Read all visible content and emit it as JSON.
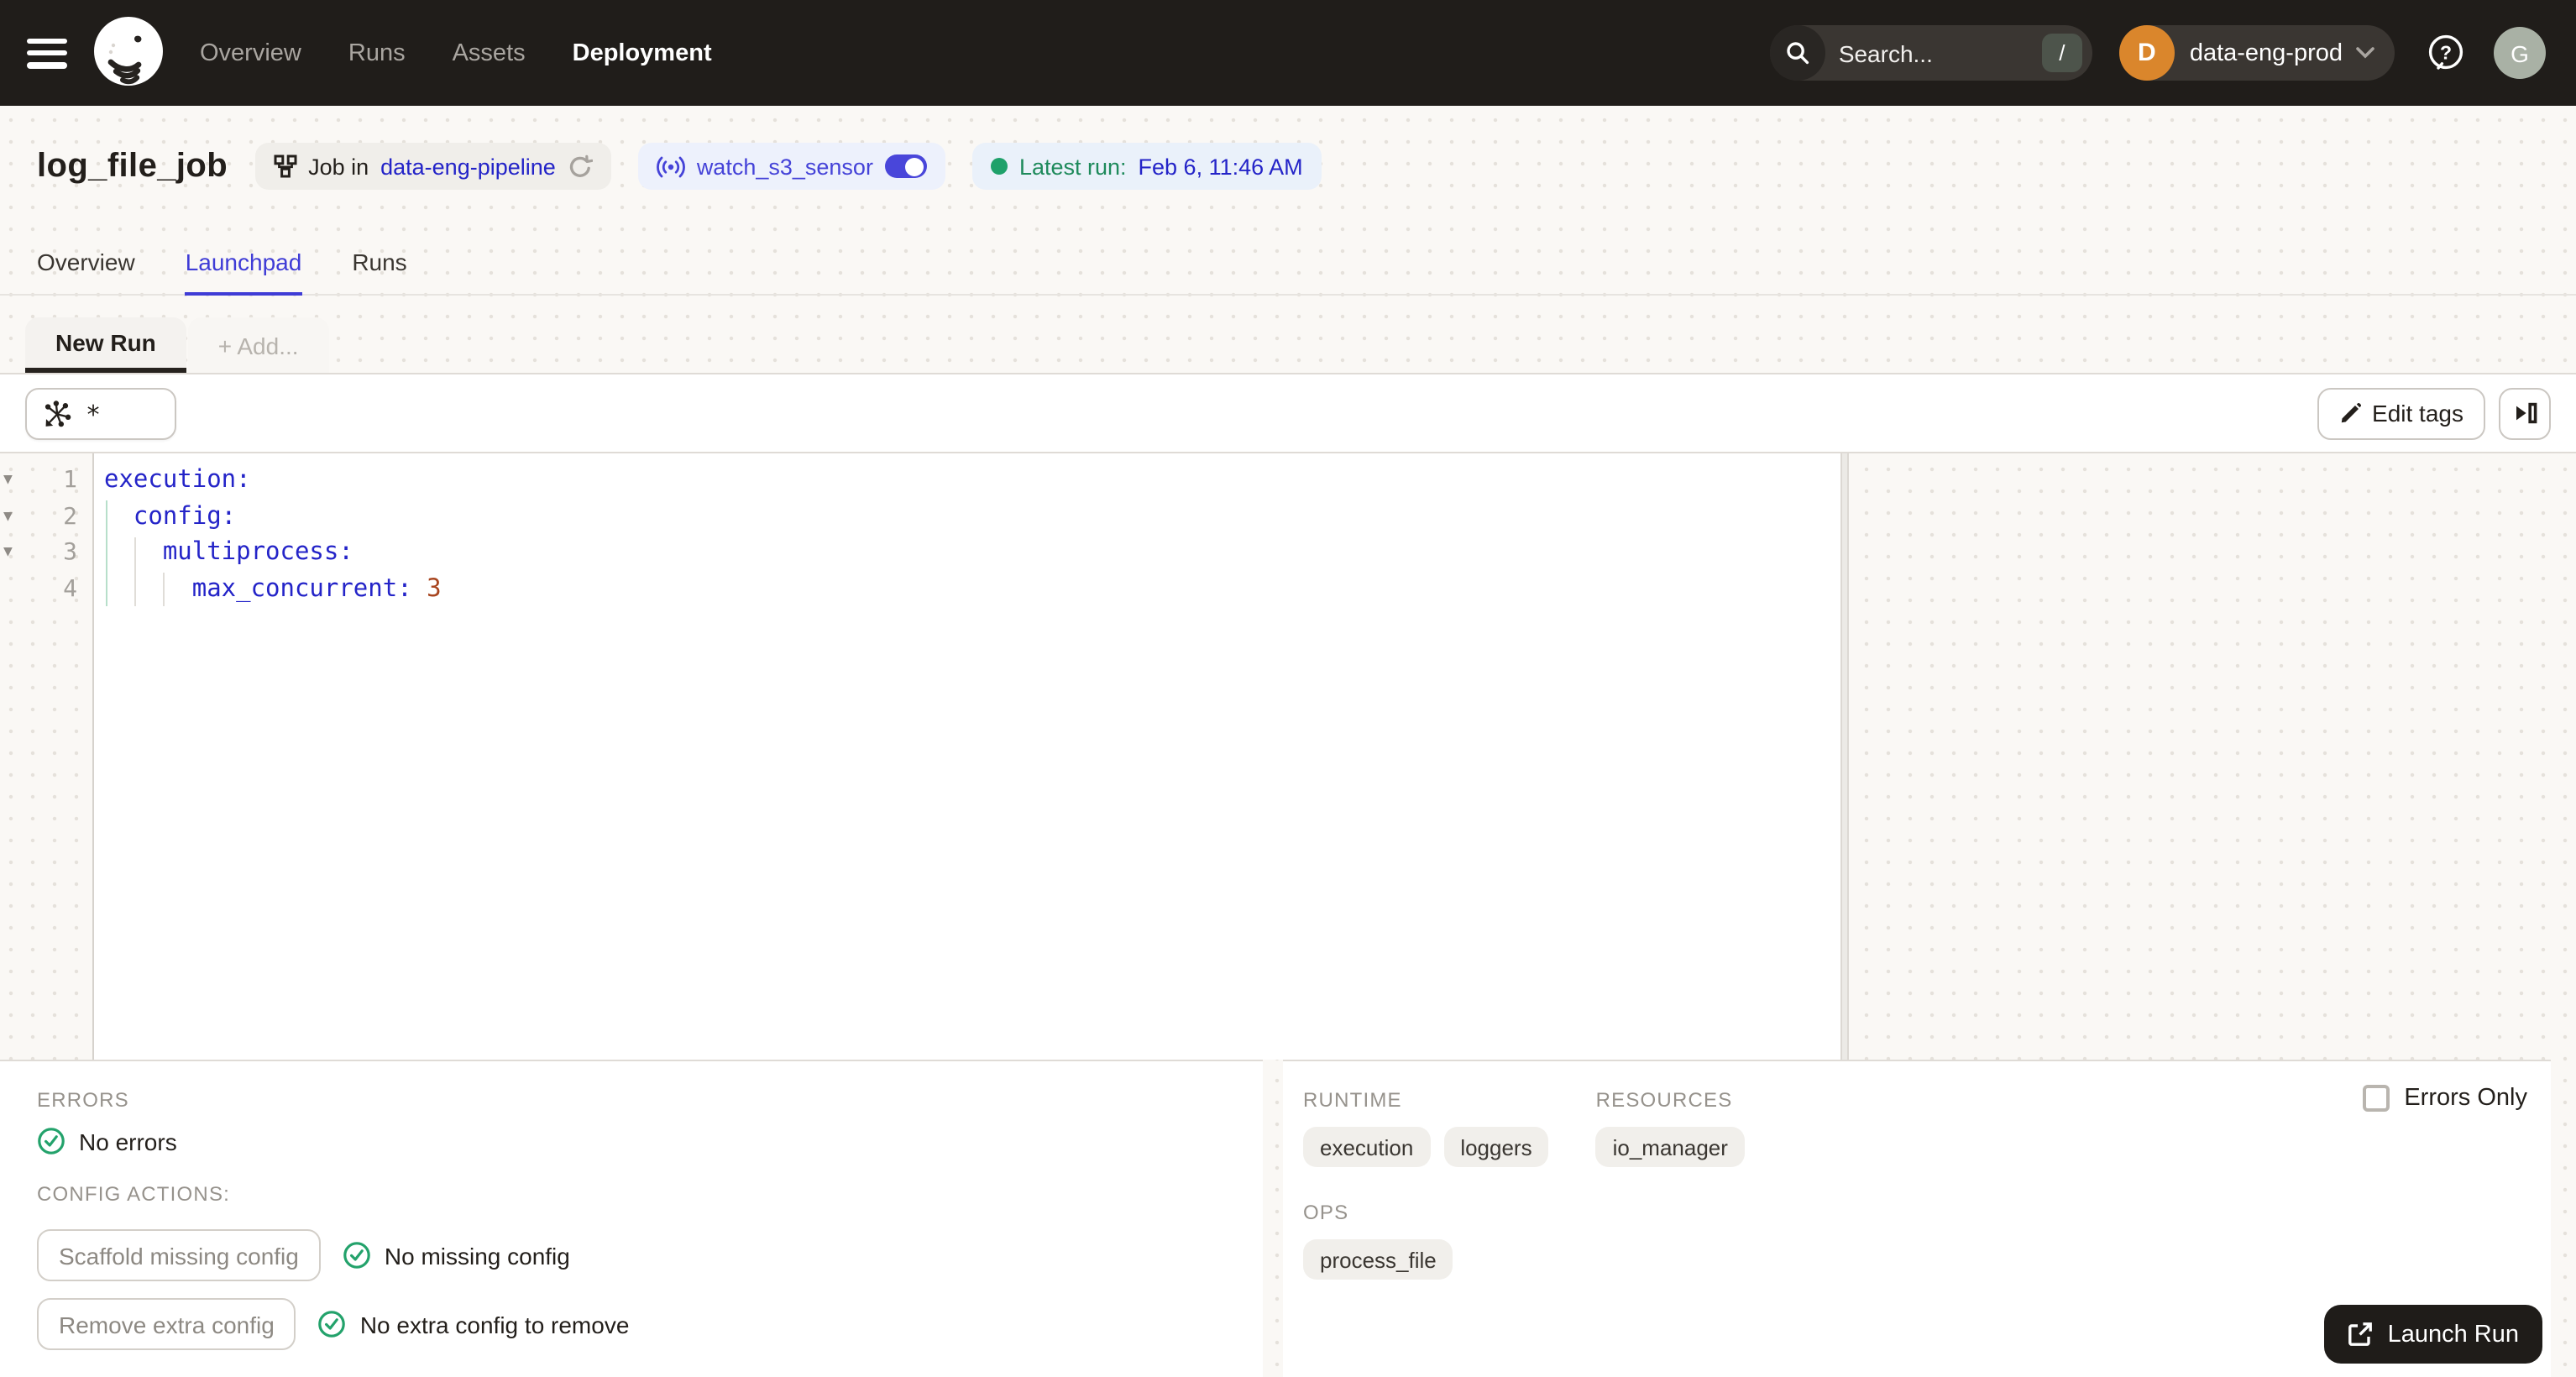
{
  "colors": {
    "header_bg": "#201d1a",
    "link_blue": "#2424c8",
    "indigo": "#4543d8",
    "green": "#1fa16a",
    "accent_tab": "#3f3cd6",
    "yaml_key": "#2424c8",
    "yaml_number": "#a8451f",
    "deployment_avatar": "#da862c",
    "user_avatar": "#a9b1a5"
  },
  "header": {
    "nav": [
      {
        "label": "Overview"
      },
      {
        "label": "Runs"
      },
      {
        "label": "Assets"
      },
      {
        "label": "Deployment",
        "active": true
      }
    ],
    "search": {
      "placeholder": "Search...",
      "shortcut": "/"
    },
    "deployment": {
      "initial": "D",
      "name": "data-eng-prod"
    },
    "user_initial": "G"
  },
  "title_bar": {
    "title": "log_file_job",
    "job_tag": {
      "prefix": "Job in",
      "repo": "data-eng-pipeline"
    },
    "sensor_tag": {
      "name": "watch_s3_sensor",
      "enabled": true
    },
    "latest_run": {
      "label": "Latest run:",
      "value": "Feb 6, 11:46 AM"
    }
  },
  "tabs": [
    {
      "label": "Overview"
    },
    {
      "label": "Launchpad",
      "active": true
    },
    {
      "label": "Runs"
    }
  ],
  "launchpad": {
    "run_tabs": {
      "active": "New Run",
      "add": "+ Add..."
    },
    "op_selector": "*",
    "edit_tags_label": "Edit tags",
    "editor": {
      "lines": [
        {
          "number": "1",
          "code": "execution:",
          "value": ""
        },
        {
          "number": "2",
          "code": "  config:",
          "value": ""
        },
        {
          "number": "3",
          "code": "    multiprocess:",
          "value": ""
        },
        {
          "number": "4",
          "code": "      max_concurrent:",
          "value": " 3"
        }
      ]
    }
  },
  "bottom": {
    "left": {
      "errors_label": "ERRORS",
      "errors_status": "No errors",
      "config_actions_label": "CONFIG ACTIONS:",
      "scaffold_button": "Scaffold missing config",
      "scaffold_status": "No missing config",
      "remove_button": "Remove extra config",
      "remove_status": "No extra config to remove"
    },
    "right": {
      "runtime_label": "RUNTIME",
      "runtime_tags": [
        "execution",
        "loggers"
      ],
      "resources_label": "RESOURCES",
      "resources_tags": [
        "io_manager"
      ],
      "ops_label": "OPS",
      "ops_tags": [
        "process_file"
      ],
      "errors_only_label": "Errors Only",
      "errors_only_checked": false
    },
    "launch_button": "Launch Run"
  }
}
